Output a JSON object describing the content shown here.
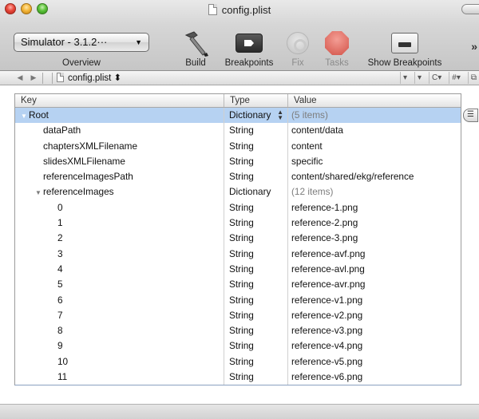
{
  "window": {
    "title": "config.plist"
  },
  "toolbar": {
    "scheme_value": "Simulator - 3.1.2···",
    "overview_label": "Overview",
    "build_label": "Build",
    "breakpoints_label": "Breakpoints",
    "fix_label": "Fix",
    "tasks_label": "Tasks",
    "show_breakpoints_label": "Show Breakpoints",
    "overflow_chevron": "»"
  },
  "navbar": {
    "back_arrow": "◀",
    "forward_arrow": "▶",
    "crumb_label": "config.plist ⬍",
    "tools": [
      "▾",
      "▾",
      "C▾",
      "#▾",
      "⧉"
    ]
  },
  "table": {
    "headers": {
      "key": "Key",
      "type": "Type",
      "value": "Value"
    },
    "rows": [
      {
        "key": "Root",
        "type": "Dictionary",
        "value": "(5 items)"
      },
      {
        "key": "dataPath",
        "type": "String",
        "value": "content/data"
      },
      {
        "key": "chaptersXMLFilename",
        "type": "String",
        "value": "content"
      },
      {
        "key": "slidesXMLFilename",
        "type": "String",
        "value": "specific"
      },
      {
        "key": "referenceImagesPath",
        "type": "String",
        "value": "content/shared/ekg/reference"
      },
      {
        "key": "referenceImages",
        "type": "Dictionary",
        "value": "(12 items)"
      },
      {
        "key": "0",
        "type": "String",
        "value": "reference-1.png"
      },
      {
        "key": "1",
        "type": "String",
        "value": "reference-2.png"
      },
      {
        "key": "2",
        "type": "String",
        "value": "reference-3.png"
      },
      {
        "key": "3",
        "type": "String",
        "value": "reference-avf.png"
      },
      {
        "key": "4",
        "type": "String",
        "value": "reference-avl.png"
      },
      {
        "key": "5",
        "type": "String",
        "value": "reference-avr.png"
      },
      {
        "key": "6",
        "type": "String",
        "value": "reference-v1.png"
      },
      {
        "key": "7",
        "type": "String",
        "value": "reference-v2.png"
      },
      {
        "key": "8",
        "type": "String",
        "value": "reference-v3.png"
      },
      {
        "key": "9",
        "type": "String",
        "value": "reference-v4.png"
      },
      {
        "key": "10",
        "type": "String",
        "value": "reference-v5.png"
      },
      {
        "key": "11",
        "type": "String",
        "value": "reference-v6.png"
      }
    ],
    "row_action_glyph": "☰"
  },
  "colors": {
    "selection": "#b6d2f2",
    "toolbar_top": "#e9e9e9",
    "toolbar_bottom": "#c6c6c6"
  }
}
